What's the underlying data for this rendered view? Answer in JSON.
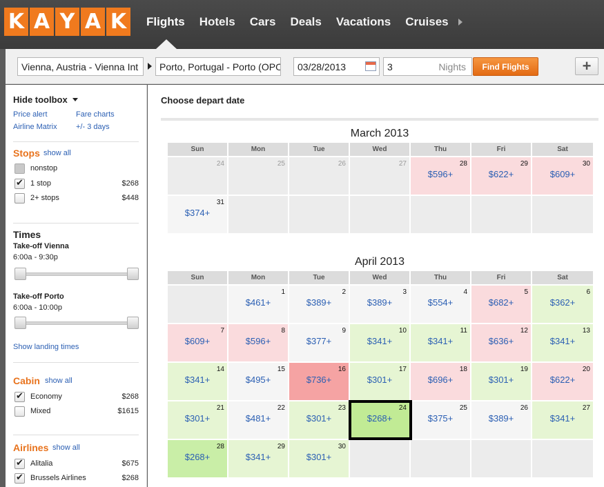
{
  "logo": {
    "letters": [
      "K",
      "A",
      "Y",
      "A",
      "K"
    ]
  },
  "nav": {
    "items": [
      "Flights",
      "Hotels",
      "Cars",
      "Deals",
      "Vacations",
      "Cruises"
    ],
    "active": "Flights"
  },
  "search": {
    "from": "Vienna, Austria - Vienna Int",
    "to": "Porto, Portugal - Porto (OPO)",
    "date": "03/28/2013",
    "nights_value": "3",
    "nights_label": "Nights",
    "find_label": "Find Flights",
    "add_label": "+"
  },
  "sidebar": {
    "hide_toolbox": "Hide toolbox",
    "links": [
      "Price alert",
      "Fare charts",
      "Airline Matrix",
      "+/- 3 days"
    ],
    "stops": {
      "title": "Stops",
      "show_all": "show all",
      "rows": [
        {
          "label": "nonstop",
          "price": "",
          "checked": false,
          "disabled": true
        },
        {
          "label": "1 stop",
          "price": "$268",
          "checked": true,
          "disabled": false
        },
        {
          "label": "2+ stops",
          "price": "$448",
          "checked": false,
          "disabled": false
        }
      ]
    },
    "times": {
      "title": "Times",
      "takeoff_vienna": "Take-off Vienna",
      "vienna_range": "6:00a - 9:30p",
      "takeoff_porto": "Take-off Porto",
      "porto_range": "6:00a - 10:00p",
      "show_landing": "Show landing times"
    },
    "cabin": {
      "title": "Cabin",
      "show_all": "show all",
      "rows": [
        {
          "label": "Economy",
          "price": "$268",
          "checked": true
        },
        {
          "label": "Mixed",
          "price": "$1615",
          "checked": false
        }
      ]
    },
    "airlines": {
      "title": "Airlines",
      "show_all": "show all",
      "rows": [
        {
          "label": "Alitalia",
          "price": "$675",
          "checked": true
        },
        {
          "label": "Brussels Airlines",
          "price": "$268",
          "checked": true
        }
      ]
    }
  },
  "main": {
    "title": "Choose depart date",
    "dow": [
      "Sun",
      "Mon",
      "Tue",
      "Wed",
      "Thu",
      "Fri",
      "Sat"
    ],
    "months": [
      {
        "name": "March 2013",
        "weeks": [
          [
            {
              "day": "24",
              "price": "",
              "tone": "e",
              "muted": true
            },
            {
              "day": "25",
              "price": "",
              "tone": "e",
              "muted": true
            },
            {
              "day": "26",
              "price": "",
              "tone": "e",
              "muted": true
            },
            {
              "day": "27",
              "price": "",
              "tone": "e",
              "muted": true
            },
            {
              "day": "28",
              "price": "$596+",
              "tone": "r"
            },
            {
              "day": "29",
              "price": "$622+",
              "tone": "r"
            },
            {
              "day": "30",
              "price": "$609+",
              "tone": "r"
            }
          ],
          [
            {
              "day": "31",
              "price": "$374+",
              "tone": "w"
            },
            {
              "day": "",
              "price": "",
              "tone": "e"
            },
            {
              "day": "",
              "price": "",
              "tone": "e"
            },
            {
              "day": "",
              "price": "",
              "tone": "e"
            },
            {
              "day": "",
              "price": "",
              "tone": "e"
            },
            {
              "day": "",
              "price": "",
              "tone": "e"
            },
            {
              "day": "",
              "price": "",
              "tone": "e"
            }
          ]
        ]
      },
      {
        "name": "April 2013",
        "weeks": [
          [
            {
              "day": "",
              "price": "",
              "tone": "e"
            },
            {
              "day": "1",
              "price": "$461+",
              "tone": "w"
            },
            {
              "day": "2",
              "price": "$389+",
              "tone": "w"
            },
            {
              "day": "3",
              "price": "$389+",
              "tone": "w"
            },
            {
              "day": "4",
              "price": "$554+",
              "tone": "w"
            },
            {
              "day": "5",
              "price": "$682+",
              "tone": "r"
            },
            {
              "day": "6",
              "price": "$362+",
              "tone": "g"
            }
          ],
          [
            {
              "day": "7",
              "price": "$609+",
              "tone": "r"
            },
            {
              "day": "8",
              "price": "$596+",
              "tone": "r"
            },
            {
              "day": "9",
              "price": "$377+",
              "tone": "w"
            },
            {
              "day": "10",
              "price": "$341+",
              "tone": "g"
            },
            {
              "day": "11",
              "price": "$341+",
              "tone": "g"
            },
            {
              "day": "12",
              "price": "$636+",
              "tone": "r"
            },
            {
              "day": "13",
              "price": "$341+",
              "tone": "g"
            }
          ],
          [
            {
              "day": "14",
              "price": "$341+",
              "tone": "g"
            },
            {
              "day": "15",
              "price": "$495+",
              "tone": "w"
            },
            {
              "day": "16",
              "price": "$736+",
              "tone": "rr"
            },
            {
              "day": "17",
              "price": "$301+",
              "tone": "g"
            },
            {
              "day": "18",
              "price": "$696+",
              "tone": "r"
            },
            {
              "day": "19",
              "price": "$301+",
              "tone": "g"
            },
            {
              "day": "20",
              "price": "$622+",
              "tone": "r"
            }
          ],
          [
            {
              "day": "21",
              "price": "$301+",
              "tone": "g"
            },
            {
              "day": "22",
              "price": "$481+",
              "tone": "w"
            },
            {
              "day": "23",
              "price": "$301+",
              "tone": "g"
            },
            {
              "day": "24",
              "price": "$268+",
              "tone": "sel"
            },
            {
              "day": "25",
              "price": "$375+",
              "tone": "w"
            },
            {
              "day": "26",
              "price": "$389+",
              "tone": "w"
            },
            {
              "day": "27",
              "price": "$341+",
              "tone": "g"
            }
          ],
          [
            {
              "day": "28",
              "price": "$268+",
              "tone": "gg"
            },
            {
              "day": "29",
              "price": "$341+",
              "tone": "g"
            },
            {
              "day": "30",
              "price": "$301+",
              "tone": "g"
            },
            {
              "day": "",
              "price": "",
              "tone": "e"
            },
            {
              "day": "",
              "price": "",
              "tone": "e"
            },
            {
              "day": "",
              "price": "",
              "tone": "e"
            },
            {
              "day": "",
              "price": "",
              "tone": "e"
            }
          ]
        ]
      }
    ]
  }
}
